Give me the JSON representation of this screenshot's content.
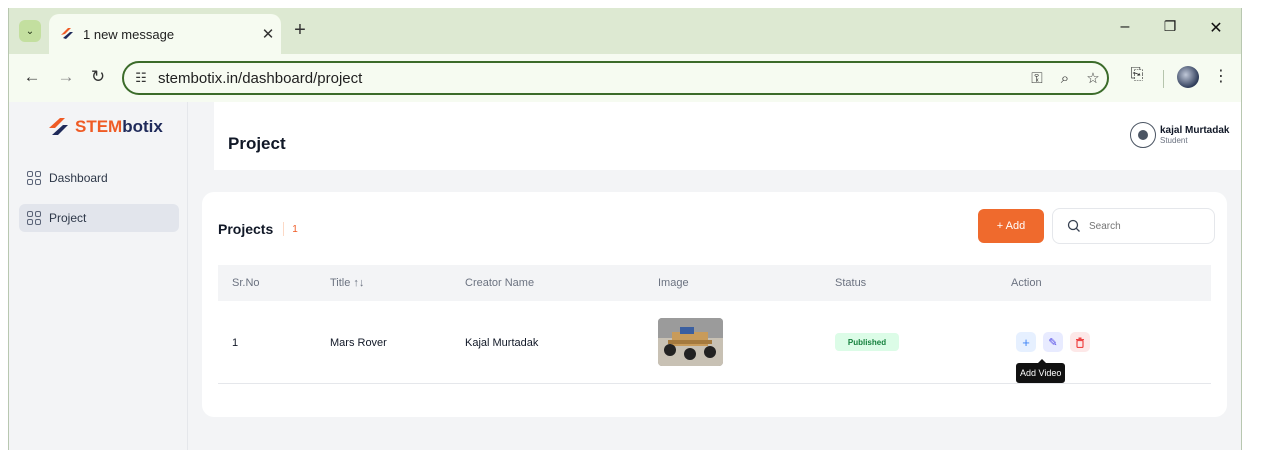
{
  "browser": {
    "tab_title": "1 new message",
    "url": "stembotix.in/dashboard/project"
  },
  "brand": {
    "stem": "STEM",
    "botix": "botix",
    "accent_color": "#ef5b25",
    "navy_color": "#1f2a5a"
  },
  "sidebar": {
    "items": [
      {
        "label": "Dashboard",
        "active": false
      },
      {
        "label": "Project",
        "active": true
      }
    ]
  },
  "header": {
    "title": "Project",
    "user_name": "kajal Murtadak",
    "user_role": "Student"
  },
  "projects": {
    "heading": "Projects",
    "count": "1",
    "add_label": "+ Add",
    "search_placeholder": "Search",
    "columns": [
      "Sr.No",
      "Title ↑↓",
      "Creator Name",
      "Image",
      "Status",
      "Action"
    ],
    "rows": [
      {
        "sr_no": "1",
        "title": "Mars Rover",
        "creator": "Kajal Murtadak",
        "status": "Published"
      }
    ],
    "tooltip": "Add Video"
  }
}
